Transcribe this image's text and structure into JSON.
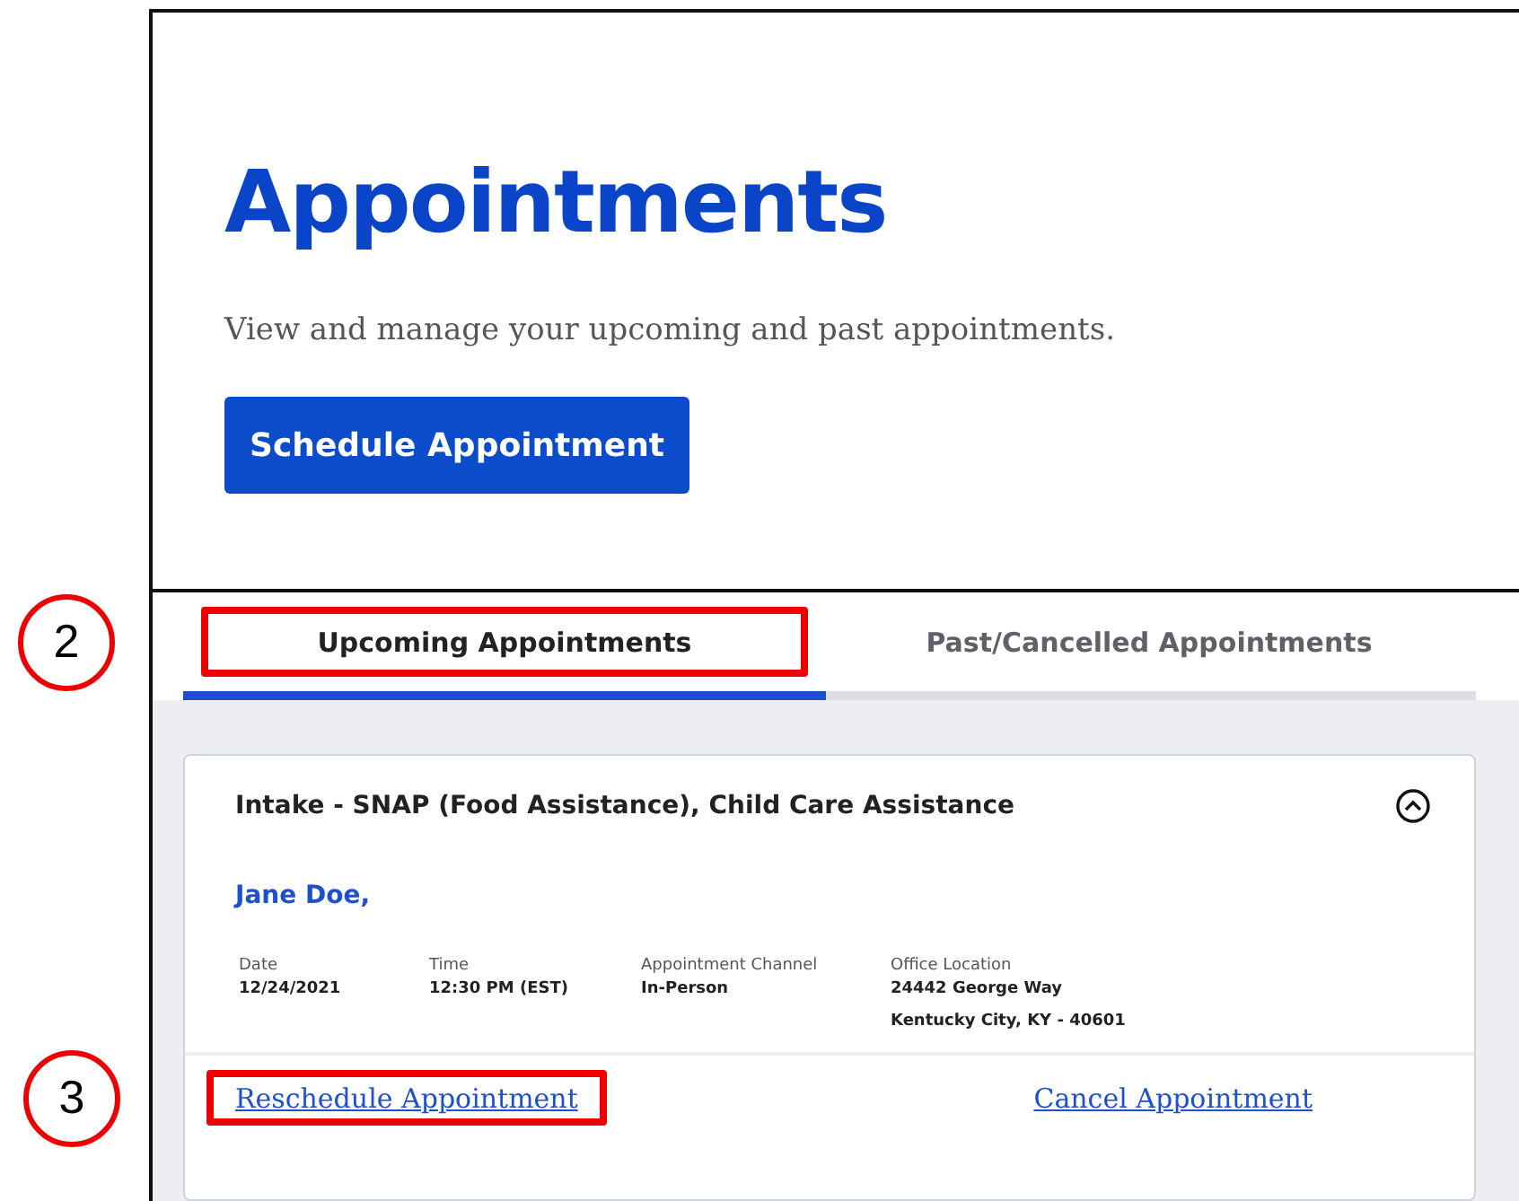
{
  "page": {
    "title": "Appointments",
    "subtitle": "View and manage your upcoming and past appointments.",
    "primary_button": "Schedule Appointment"
  },
  "tabs": [
    {
      "label": "Upcoming Appointments",
      "selected": true,
      "callout": "2"
    },
    {
      "label": "Past/Cancelled Appointments",
      "selected": false
    }
  ],
  "appointment": {
    "title": "Intake - SNAP (Food Assistance), Child Care Assistance",
    "expanded": true,
    "person": "Jane Doe,",
    "fields": [
      {
        "label": "Date",
        "lines": [
          "12/24/2021"
        ]
      },
      {
        "label": "Time",
        "lines": [
          "12:30 PM (EST)"
        ]
      },
      {
        "label": "Appointment Channel",
        "lines": [
          "In-Person"
        ]
      },
      {
        "label": "Office Location",
        "lines": [
          "24442 George Way",
          "Kentucky City, KY - 40601"
        ]
      }
    ],
    "actions": [
      {
        "label": "Reschedule Appointment",
        "callout": "3"
      },
      {
        "label": "Cancel Appointment"
      }
    ]
  }
}
